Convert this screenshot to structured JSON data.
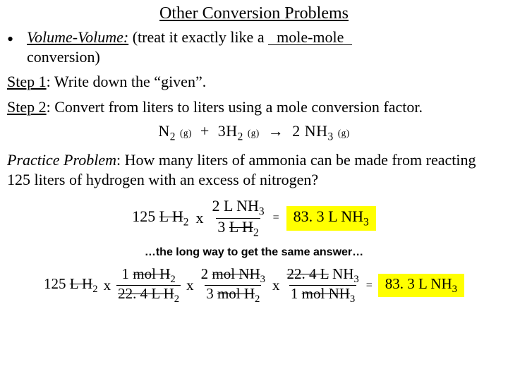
{
  "title": "Other Conversion Problems",
  "bullet": {
    "lead": "Volume-Volume:",
    "mid": "  (treat it exactly like a ",
    "fill": "mole-mole",
    "tail": " conversion)"
  },
  "step1": {
    "label": "Step 1",
    "text": ": Write down the “given”."
  },
  "step2": {
    "label": "Step 2",
    "text": ": Convert from liters to liters using a mole conversion factor."
  },
  "equation": {
    "r1": {
      "c": "",
      "f": "N",
      "s": "2",
      "p": "(g)"
    },
    "plus": "+",
    "r2": {
      "c": "3",
      "f": "H",
      "s": "2",
      "p": "(g)"
    },
    "arrow": "→",
    "p1": {
      "c": "2",
      "f": "NH",
      "s": "3",
      "p": "(g)"
    }
  },
  "practice": {
    "label": "Practice Problem",
    "text": ":  How many liters of ammonia can be made from reacting 125 liters of hydrogen with an excess of nitrogen?"
  },
  "dim1": {
    "given_v": "125 ",
    "given_u_strike": "L H",
    "given_sub": "2",
    "x": "x",
    "num_v": "2 L NH",
    "num_sub": "3",
    "den_v": "3 ",
    "den_u_strike": "L H",
    "den_sub": "2",
    "eq": "=",
    "ans": "83. 3 L NH",
    "ans_sub": "3"
  },
  "longway": "…the long way to get the same answer…",
  "dim2": {
    "t1": {
      "pre": "125 ",
      "st": "L H",
      "sub": "2"
    },
    "x": "x",
    "f1": {
      "num_pre": "1 ",
      "num_st": "mol H",
      "num_sub": "2",
      "den_pre": "",
      "den_st": "22. 4 L H",
      "den_sub": "2"
    },
    "f2": {
      "num_pre": "2 ",
      "num_st": "mol NH",
      "num_sub": "3",
      "den_pre": "3 ",
      "den_st": "mol H",
      "den_sub": "2"
    },
    "f3": {
      "num_pre": "",
      "num_st": "22. 4 L",
      "num_tail": " NH",
      "num_sub": "3",
      "den_pre": "1 ",
      "den_st": "mol NH",
      "den_sub": "3"
    },
    "eq": "=",
    "ans": "83. 3 L NH",
    "ans_sub": "3"
  }
}
